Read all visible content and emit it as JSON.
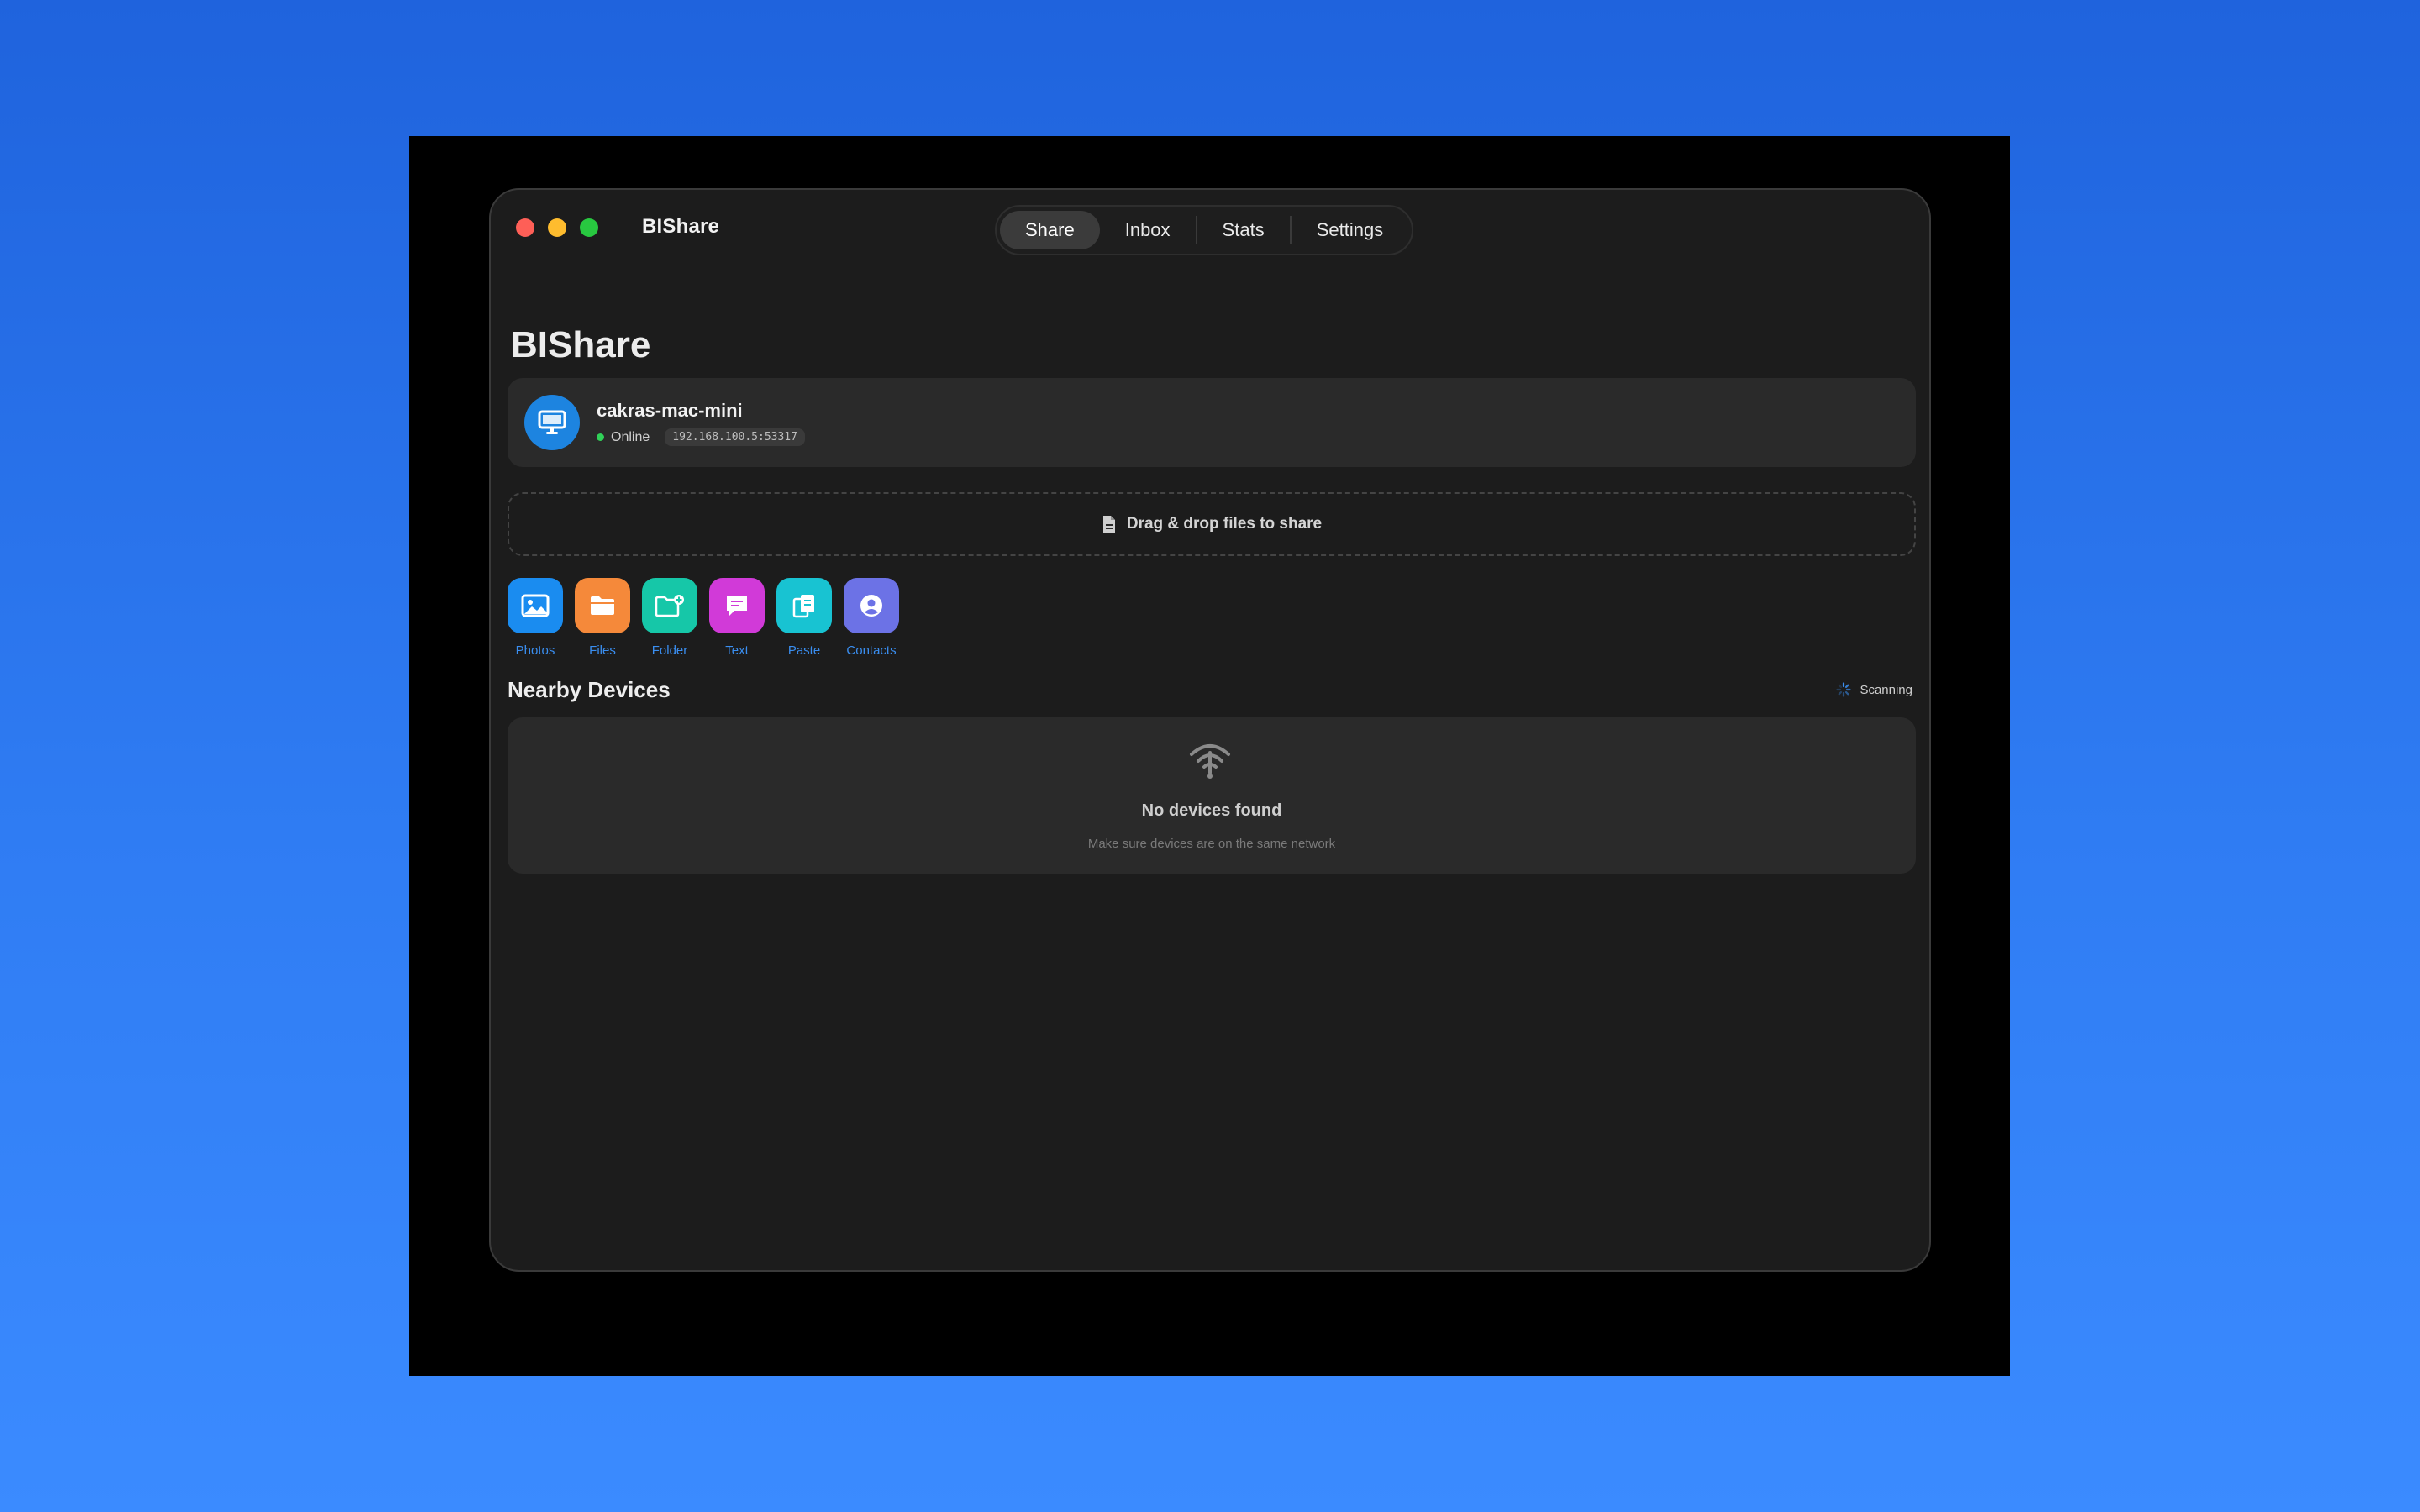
{
  "window": {
    "title": "BIShare"
  },
  "tabs": [
    {
      "label": "Share",
      "active": true
    },
    {
      "label": "Inbox",
      "active": false
    },
    {
      "label": "Stats",
      "active": false
    },
    {
      "label": "Settings",
      "active": false
    }
  ],
  "page": {
    "title": "BIShare"
  },
  "device": {
    "name": "cakras-mac-mini",
    "status": "Online",
    "address": "192.168.100.5:53317",
    "icon": "desktop-computer-icon",
    "status_color": "#30d158"
  },
  "dropzone": {
    "label": "Drag & drop files to share",
    "icon": "document-icon"
  },
  "actions": [
    {
      "label": "Photos",
      "icon": "photo-icon",
      "color": "#1a8cf0"
    },
    {
      "label": "Files",
      "icon": "folder-icon",
      "color": "#f5893a"
    },
    {
      "label": "Folder",
      "icon": "folder-badge-plus-icon",
      "color": "#16c7a8"
    },
    {
      "label": "Text",
      "icon": "text-bubble-icon",
      "color": "#d13ad8"
    },
    {
      "label": "Paste",
      "icon": "clipboard-icon",
      "color": "#18c3d2"
    },
    {
      "label": "Contacts",
      "icon": "person-circle-icon",
      "color": "#6c72e6"
    }
  ],
  "nearby": {
    "title": "Nearby Devices",
    "scanning_label": "Scanning",
    "empty_title": "No devices found",
    "empty_subtitle": "Make sure devices are on the same network",
    "empty_icon": "wifi-off-icon"
  },
  "colors": {
    "accent": "#3a8ef0",
    "window_bg": "#1c1c1c",
    "card_bg": "#2a2a2a"
  }
}
